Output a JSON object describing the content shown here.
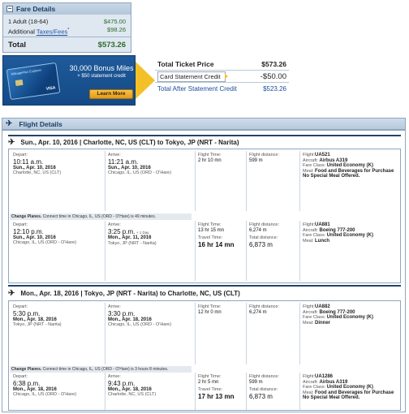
{
  "fare": {
    "title": "Fare Details",
    "adult_label": "1 Adult (18-64)",
    "adult_value": "$475.00",
    "additional_label": "Additional",
    "taxes_link": "Taxes/Fees",
    "taxes_marker": "*",
    "taxes_value": "$98.26",
    "total_label": "Total",
    "total_value": "$573.26"
  },
  "promo": {
    "card_name": "MileagePlus Explorer",
    "card_brand": "VISA",
    "headline": "30,000 Bonus Miles",
    "subline": "+ $50 statement credit",
    "button": "Learn More"
  },
  "price": {
    "total_label": "Total Ticket Price",
    "total_value": "$573.26",
    "credit_label": "Card Statement Credit",
    "credit_value": "-$50.00",
    "after_label": "Total After Statement Credit",
    "after_value": "$523.26"
  },
  "flight_details": {
    "title": "Flight Details",
    "segments": [
      {
        "title": "Sun., Apr. 10, 2016 | Charlotte, NC, US (CLT) to Tokyo, JP (NRT - Narita)",
        "legs": [
          {
            "depart_label": "Depart:",
            "depart_time": "10:11 a.m.",
            "depart_date": "Sun., Apr. 10, 2016",
            "depart_city": "Charlotte, NC, US (CLT)",
            "arrive_label": "Arrive:",
            "arrive_time": "11:21 a.m.",
            "arrive_extra": "",
            "arrive_date": "Sun., Apr. 10, 2016",
            "arrive_city": "Chicago, IL, US (ORD - O'Hare)",
            "ft_label": "Flight Time:",
            "ft_value": "2 hr 10 mn",
            "tt_label": "",
            "tt_value": "",
            "fd_label": "Flight distance:",
            "fd_value": "599 m",
            "td_label": "",
            "td_value": "",
            "flight_label": "Flight:",
            "flight_value": "UA521",
            "aircraft_label": "Aircraft:",
            "aircraft_value": "Airbus A319",
            "class_label": "Fare Class:",
            "class_value": "United Economy (K)",
            "meal_label": "Meal:",
            "meal_value": "Food and Beverages for Purchase",
            "meal_note": "No Special Meal Offered."
          },
          {
            "depart_label": "Depart:",
            "depart_time": "12:10 p.m.",
            "depart_date": "Sun., Apr. 10, 2016",
            "depart_city": "Chicago, IL, US (ORD - O'Hare)",
            "arrive_label": "Arrive:",
            "arrive_time": "3:25 p.m.",
            "arrive_extra": "+ 1 Day",
            "arrive_date": "Mon., Apr. 11, 2016",
            "arrive_city": "Tokyo, JP (NRT - Narita)",
            "ft_label": "Flight Time:",
            "ft_value": "13 hr 15 mn",
            "tt_label": "Travel Time:",
            "tt_value": "16 hr 14 mn",
            "fd_label": "Flight distance:",
            "fd_value": "6,274 m",
            "td_label": "Total distance:",
            "td_value": "6,873 m",
            "flight_label": "Flight:",
            "flight_value": "UA881",
            "aircraft_label": "Aircraft:",
            "aircraft_value": "Boeing 777-200",
            "class_label": "Fare Class:",
            "class_value": "United Economy (K)",
            "meal_label": "Meal:",
            "meal_value": "Lunch",
            "meal_note": ""
          }
        ],
        "change_bold": "Change Planes.",
        "change_text": "Connect time in Chicago, IL, US (ORD - O'Hare) is 49 minutes."
      },
      {
        "title": "Mon., Apr. 18, 2016 | Tokyo, JP (NRT - Narita) to Charlotte, NC, US (CLT)",
        "legs": [
          {
            "depart_label": "Depart:",
            "depart_time": "5:30 p.m.",
            "depart_date": "Mon., Apr. 18, 2016",
            "depart_city": "Tokyo, JP (NRT - Narita)",
            "arrive_label": "Arrive:",
            "arrive_time": "3:30 p.m.",
            "arrive_extra": "",
            "arrive_date": "Mon., Apr. 18, 2016",
            "arrive_city": "Chicago, IL, US (ORD - O'Hare)",
            "ft_label": "Flight Time:",
            "ft_value": "12 hr 0 mn",
            "tt_label": "",
            "tt_value": "",
            "fd_label": "Flight distance:",
            "fd_value": "6,274 m",
            "td_label": "",
            "td_value": "",
            "flight_label": "Flight:",
            "flight_value": "UA882",
            "aircraft_label": "Aircraft:",
            "aircraft_value": "Boeing 777-200",
            "class_label": "Fare Class:",
            "class_value": "United Economy (K)",
            "meal_label": "Meal:",
            "meal_value": "Dinner",
            "meal_note": ""
          },
          {
            "depart_label": "Depart:",
            "depart_time": "6:38 p.m.",
            "depart_date": "Mon., Apr. 18, 2016",
            "depart_city": "Chicago, IL, US (ORD - O'Hare)",
            "arrive_label": "Arrive:",
            "arrive_time": "9:43 p.m.",
            "arrive_extra": "",
            "arrive_date": "Mon., Apr. 18, 2016",
            "arrive_city": "Charlotte, NC, US (CLT)",
            "ft_label": "Flight Time:",
            "ft_value": "2 hr 5 mn",
            "tt_label": "Travel Time:",
            "tt_value": "17 hr 13 mn",
            "fd_label": "Flight distance:",
            "fd_value": "599 m",
            "td_label": "Total distance:",
            "td_value": "6,873 m",
            "flight_label": "Flight:",
            "flight_value": "UA1286",
            "aircraft_label": "Aircraft:",
            "aircraft_value": "Airbus A319",
            "class_label": "Fare Class:",
            "class_value": "United Economy (K)",
            "meal_label": "Meal:",
            "meal_value": "Food and Beverages for Purchase",
            "meal_note": "No Special Meal Offered."
          }
        ],
        "change_bold": "Change Planes.",
        "change_text": "Connect time in Chicago, IL, US (ORD - O'Hare) is 3 hours 8 minutes."
      }
    ]
  }
}
